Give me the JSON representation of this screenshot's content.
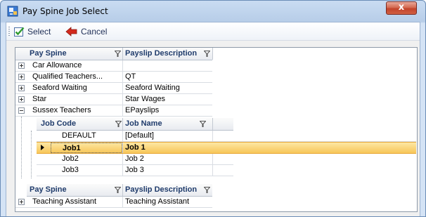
{
  "window": {
    "title": "Pay Spine Job Select",
    "close_glyph": "x",
    "icon": "app-icon"
  },
  "toolbar": {
    "select_label": "Select",
    "cancel_label": "Cancel",
    "select_icon": "checkbox-check-icon",
    "cancel_icon": "red-back-arrow-icon"
  },
  "grid": {
    "columns": [
      "Pay Spine",
      "Payslip Description"
    ],
    "rows": [
      {
        "pay_spine": "Car Allowance",
        "payslip_description": "",
        "expanded": false
      },
      {
        "pay_spine": "Qualified Teachers...",
        "payslip_description": "QT",
        "expanded": false
      },
      {
        "pay_spine": "Seaford Waiting",
        "payslip_description": "Seaford Waiting",
        "expanded": false
      },
      {
        "pay_spine": "Star",
        "payslip_description": "Star Wages",
        "expanded": false
      },
      {
        "pay_spine": "Sussex Teachers",
        "payslip_description": "EPayslips",
        "expanded": true
      }
    ],
    "detail": {
      "columns": [
        "Job Code",
        "Job Name"
      ],
      "rows": [
        {
          "job_code": "DEFAULT",
          "job_name": "[Default]"
        },
        {
          "job_code": "Job1",
          "job_name": "Job 1",
          "selected": true
        },
        {
          "job_code": "Job2",
          "job_name": "Job 2"
        },
        {
          "job_code": "Job3",
          "job_name": "Job 3"
        }
      ]
    },
    "after_columns": [
      "Pay Spine",
      "Payslip Description"
    ],
    "after_rows": [
      {
        "pay_spine": "Teaching Assistant",
        "payslip_description": "Teaching Assistant",
        "expanded": false
      }
    ]
  },
  "colors": {
    "selection_top": "#fde7a4",
    "selection_bottom": "#f7c659",
    "header_text": "#1f3b6b",
    "close_button": "#c2442b"
  }
}
